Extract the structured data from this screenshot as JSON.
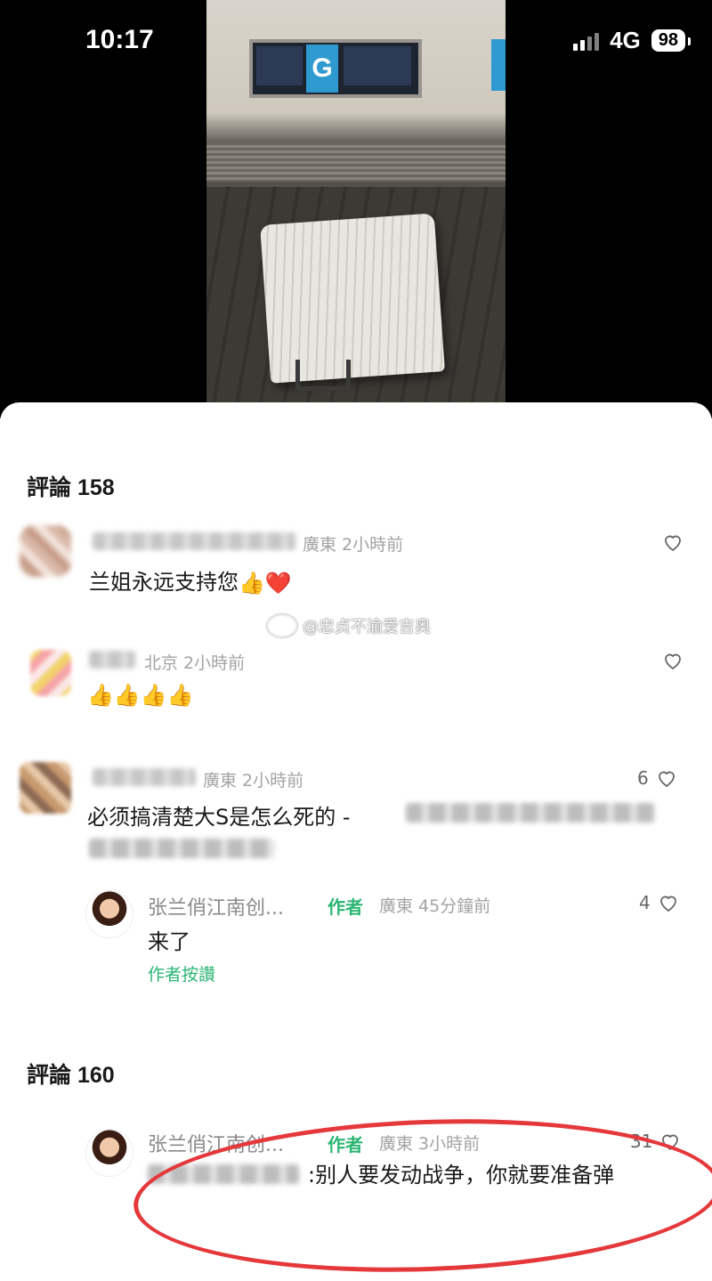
{
  "status_bar": {
    "time": "10:17",
    "network": "4G",
    "battery": "98"
  },
  "video": {
    "gate_letter": "G"
  },
  "section1": {
    "header": "評論 158",
    "comments": [
      {
        "meta": "廣東 2小時前",
        "text": "兰姐永远支持您",
        "emoji": "👍❤️",
        "likes": ""
      },
      {
        "meta": "北京 2小時前",
        "text": "",
        "emoji": "👍👍👍👍",
        "likes": ""
      },
      {
        "meta": "廣東 2小時前",
        "text": "必须搞清楚大S是怎么死的 -",
        "likes": "6"
      }
    ],
    "reply": {
      "name": "张兰俏江南创...",
      "author_tag": "作者",
      "meta": "廣東 45分鐘前",
      "text": "来了",
      "liked_by_author": "作者按讚",
      "likes": "4"
    }
  },
  "watermark": "@忠贞不渝爱吉奥",
  "section2": {
    "header": "評論 160",
    "reply": {
      "name": "张兰俏江南创...",
      "author_tag": "作者",
      "meta": "廣東 3小時前",
      "text": ":别人要发动战争，你就要准备弹",
      "likes": "31"
    }
  },
  "colors": {
    "accent_green": "#2bb673",
    "annotation_red": "#e5383b"
  }
}
